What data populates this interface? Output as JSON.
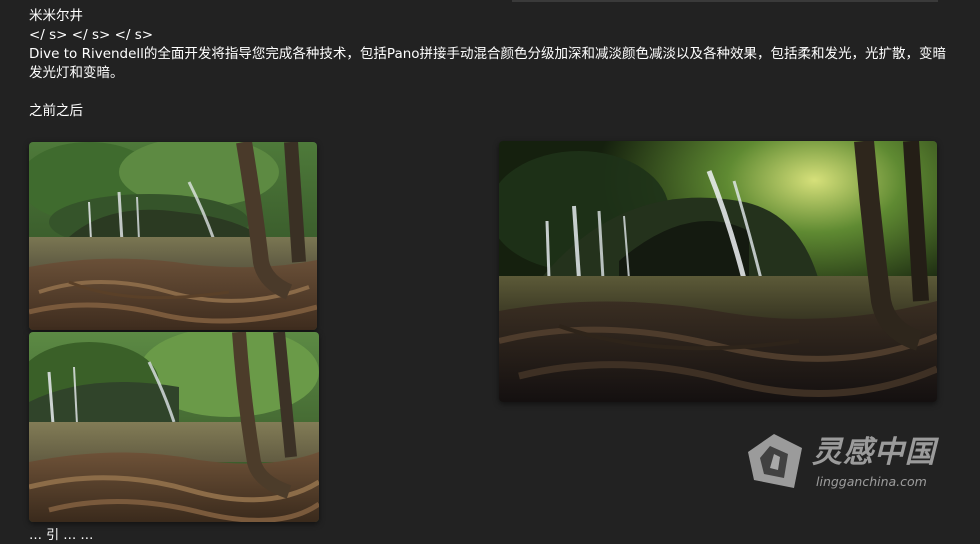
{
  "article": {
    "heading": "米米尔井",
    "tags_line": "</ s> </ s> </ s>",
    "description": "Dive to Rivendell的全面开发将指导您完成各种技术，包括Pano拼接手动混合颜色分级加深和减淡颜色减淡以及各种效果，包括柔和发光，光扩散，变暗发光灯和变暗。",
    "before_after_label": "之前之后",
    "truncated_next_line": "… 引 … …"
  },
  "images": {
    "before_top": "waterfall-forest-before-1",
    "before_bottom": "waterfall-forest-before-2",
    "after": "waterfall-forest-after"
  },
  "watermark": {
    "title": "灵感中国",
    "url": "lingganchina.com"
  },
  "colors": {
    "background": "#222222",
    "text": "#ffffff",
    "watermark": "#ffffff"
  }
}
